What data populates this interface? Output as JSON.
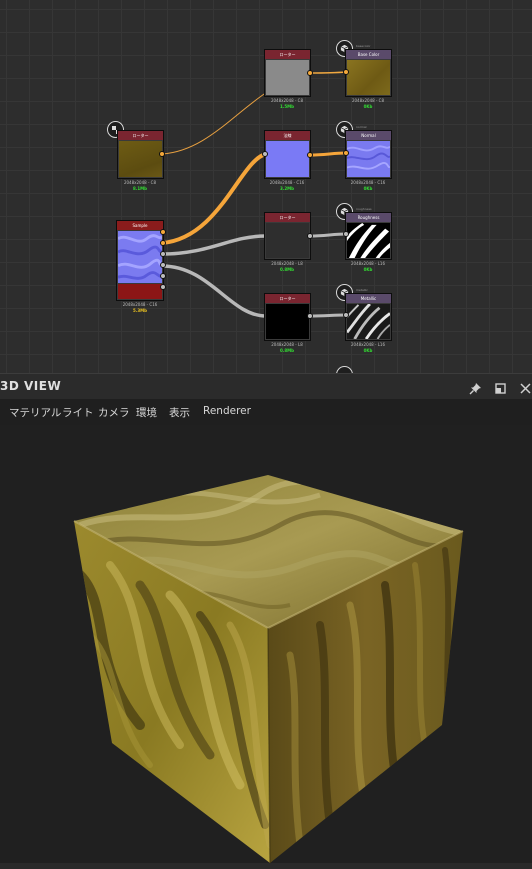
{
  "graph": {
    "nodes": {
      "gray_node": {
        "header": "ローター",
        "caption": "2048x2048 - C8",
        "memory": "1.5Mb"
      },
      "base_color": {
        "header": "Base Color",
        "caption": "2048x2048 - C8",
        "memory": "0Kb"
      },
      "tex_node": {
        "header": "ローター",
        "caption": "2048x2048 - C8",
        "memory": "8.1Mb"
      },
      "blue_node": {
        "header": "法線",
        "caption": "2048x2048 - C16",
        "memory": "3.2Mb"
      },
      "normal_out": {
        "header": "Normal",
        "caption": "2048x2048 - C16",
        "memory": "0Kb"
      },
      "sample": {
        "header": "Sample",
        "caption": "2048x2048 - C16",
        "memory": "5.3Mb"
      },
      "dark_node": {
        "header": "ローター",
        "caption": "2048x2048 - L8",
        "memory": "0.8Mb"
      },
      "roughness_out": {
        "header": "Roughness",
        "caption": "2048x2048 - L16",
        "memory": "0Kb"
      },
      "black_node": {
        "header": "ローター",
        "caption": "2048x2048 - L8",
        "memory": "0.8Mb"
      },
      "metallic_out": {
        "header": "Metallic",
        "caption": "2048x2048 - L16",
        "memory": "0Kb"
      }
    },
    "out_labels": [
      "basecolor",
      "normal",
      "roughness",
      "metallic"
    ]
  },
  "viewer": {
    "title": "3D VIEW",
    "icons": [
      "pin-icon",
      "restore-icon",
      "close-icon"
    ],
    "menu": [
      "マテリアル",
      "ライト",
      "カメラ",
      "環境",
      "表示",
      "Renderer"
    ]
  }
}
